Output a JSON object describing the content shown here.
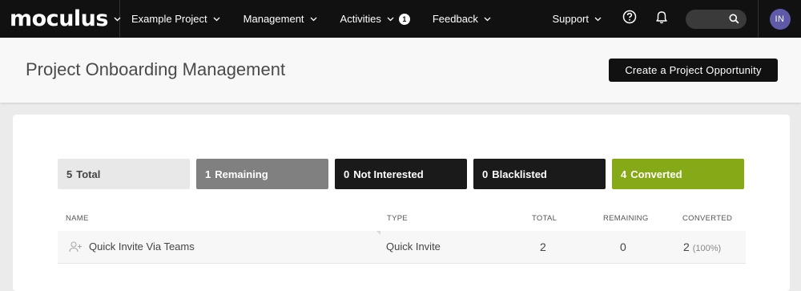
{
  "nav": {
    "logo": "moculus",
    "menu": [
      {
        "label": "Example Project"
      },
      {
        "label": "Management"
      },
      {
        "label": "Activities",
        "badge": "1"
      },
      {
        "label": "Feedback"
      }
    ],
    "support": "Support",
    "avatar_initials": "IN",
    "avatar_color": "#5e5aa8"
  },
  "header": {
    "title": "Project Onboarding Management",
    "create_button": "Create a Project Opportunity"
  },
  "stats": [
    {
      "count": "5",
      "label": "Total",
      "color": "#e8e8e8"
    },
    {
      "count": "1",
      "label": "Remaining",
      "color": "#808080"
    },
    {
      "count": "0",
      "label": "Not Interested",
      "color": "#1a1a1a"
    },
    {
      "count": "0",
      "label": "Blacklisted",
      "color": "#1a1a1a"
    },
    {
      "count": "4",
      "label": "Converted",
      "color": "#86a917"
    }
  ],
  "table": {
    "columns": [
      "NAME",
      "TYPE",
      "TOTAL",
      "REMAINING",
      "CONVERTED"
    ],
    "rows": [
      {
        "name": "Quick Invite Via Teams",
        "type": "Quick Invite",
        "total": "2",
        "remaining": "0",
        "converted": "2",
        "converted_pct": "(100%)"
      }
    ]
  }
}
